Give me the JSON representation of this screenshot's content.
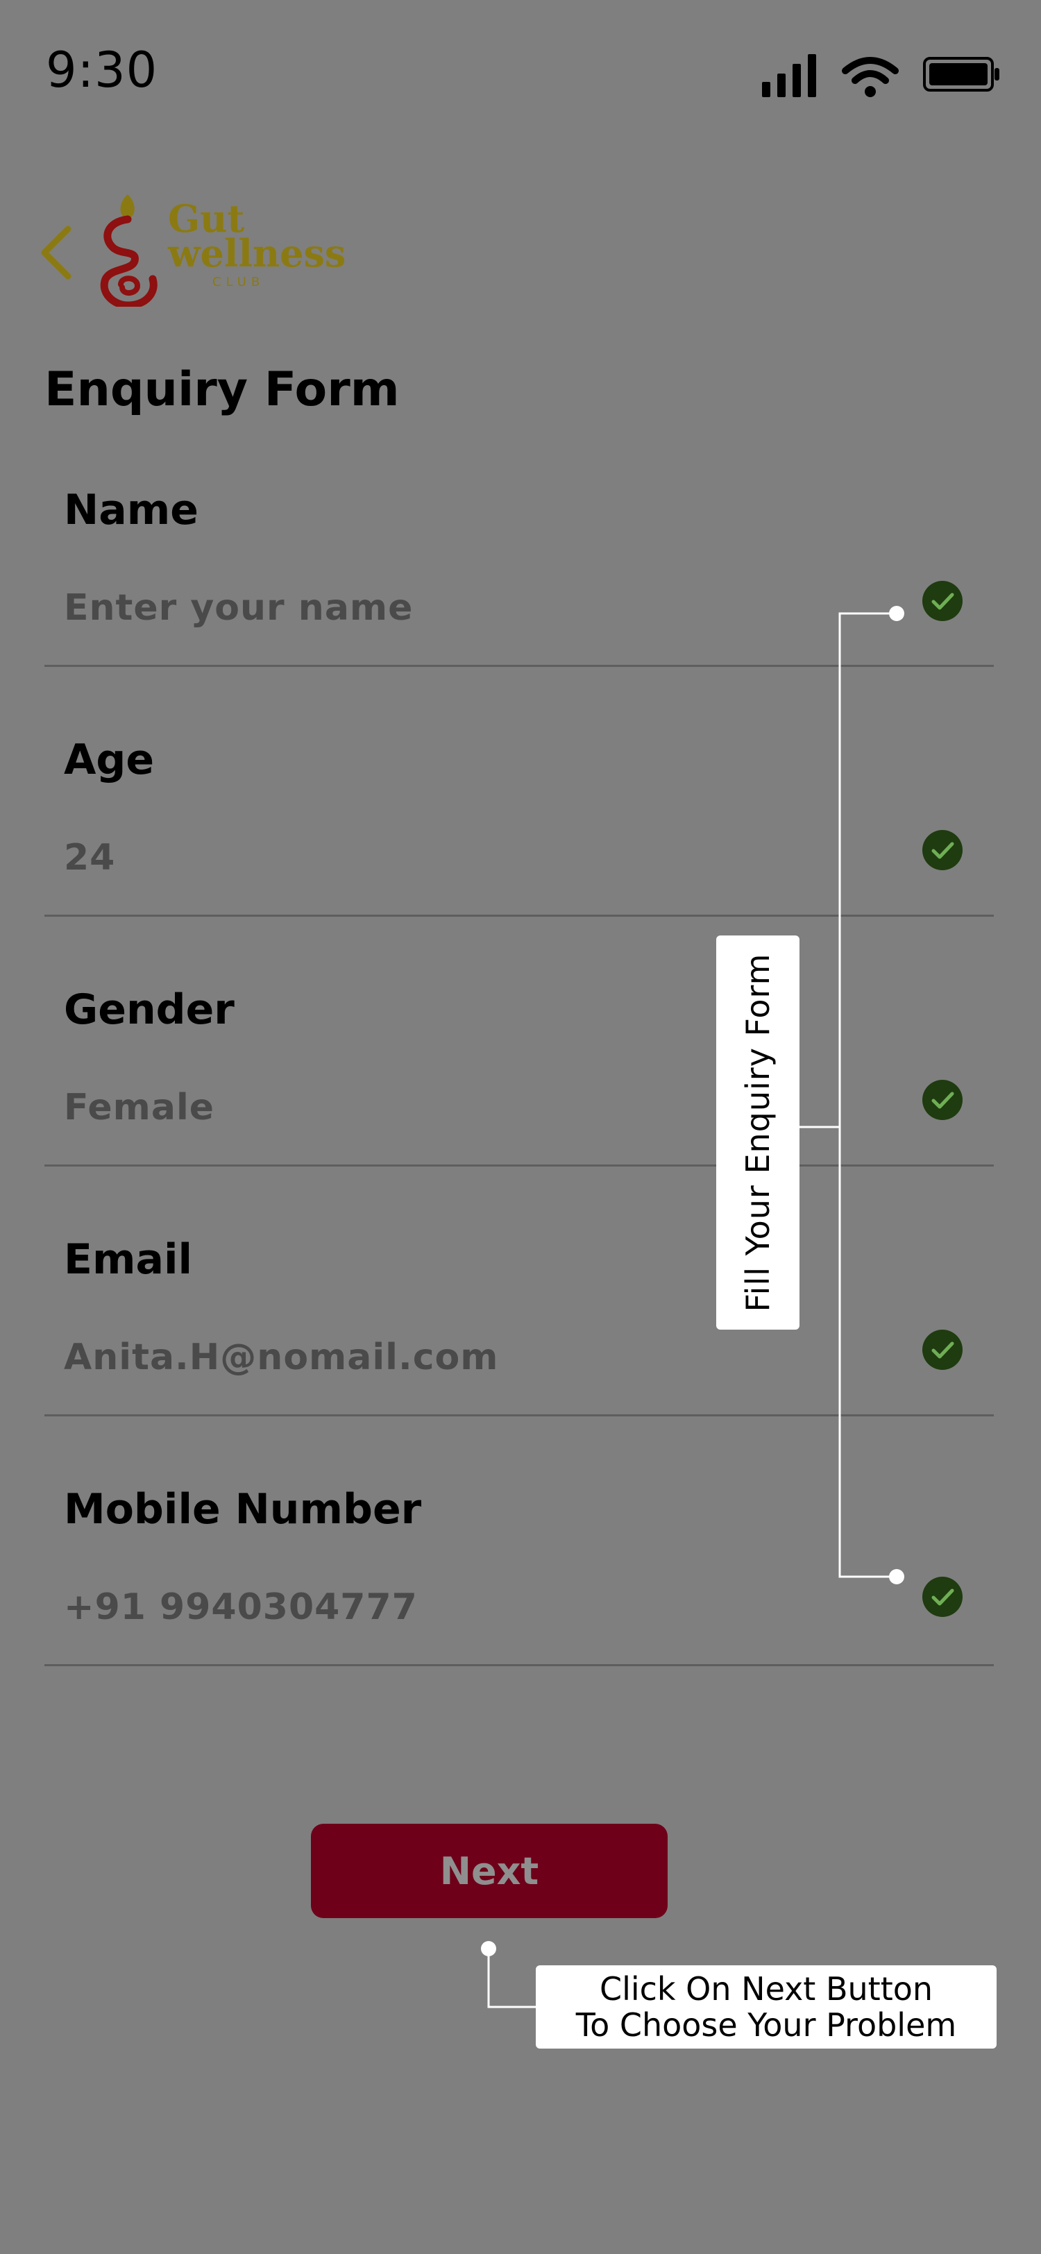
{
  "status_bar": {
    "time": "9:30"
  },
  "header": {
    "logo": {
      "line1": "Gut",
      "line2": "wellness",
      "line3": "CLUB"
    }
  },
  "page": {
    "title": "Enquiry Form"
  },
  "fields": [
    {
      "label": "Name",
      "value": "",
      "placeholder": "Enter your name"
    },
    {
      "label": "Age",
      "value": "24"
    },
    {
      "label": "Gender",
      "value": "Female"
    },
    {
      "label": "Email",
      "value": "Anita.H@nomail.com"
    },
    {
      "label": "Mobile Number",
      "value": "+91 9940304777"
    }
  ],
  "next_button": {
    "label": "Next"
  },
  "annotations": {
    "form_hint": "Fill Your Enquiry Form",
    "next_hint_line1": "Click On Next Button",
    "next_hint_line2": "To Choose Your Problem"
  },
  "colors": {
    "background": "#7f7f7f",
    "accent_gold": "#8b7a12",
    "brand_red": "#6e0019",
    "check_green": "#1f3b10"
  }
}
